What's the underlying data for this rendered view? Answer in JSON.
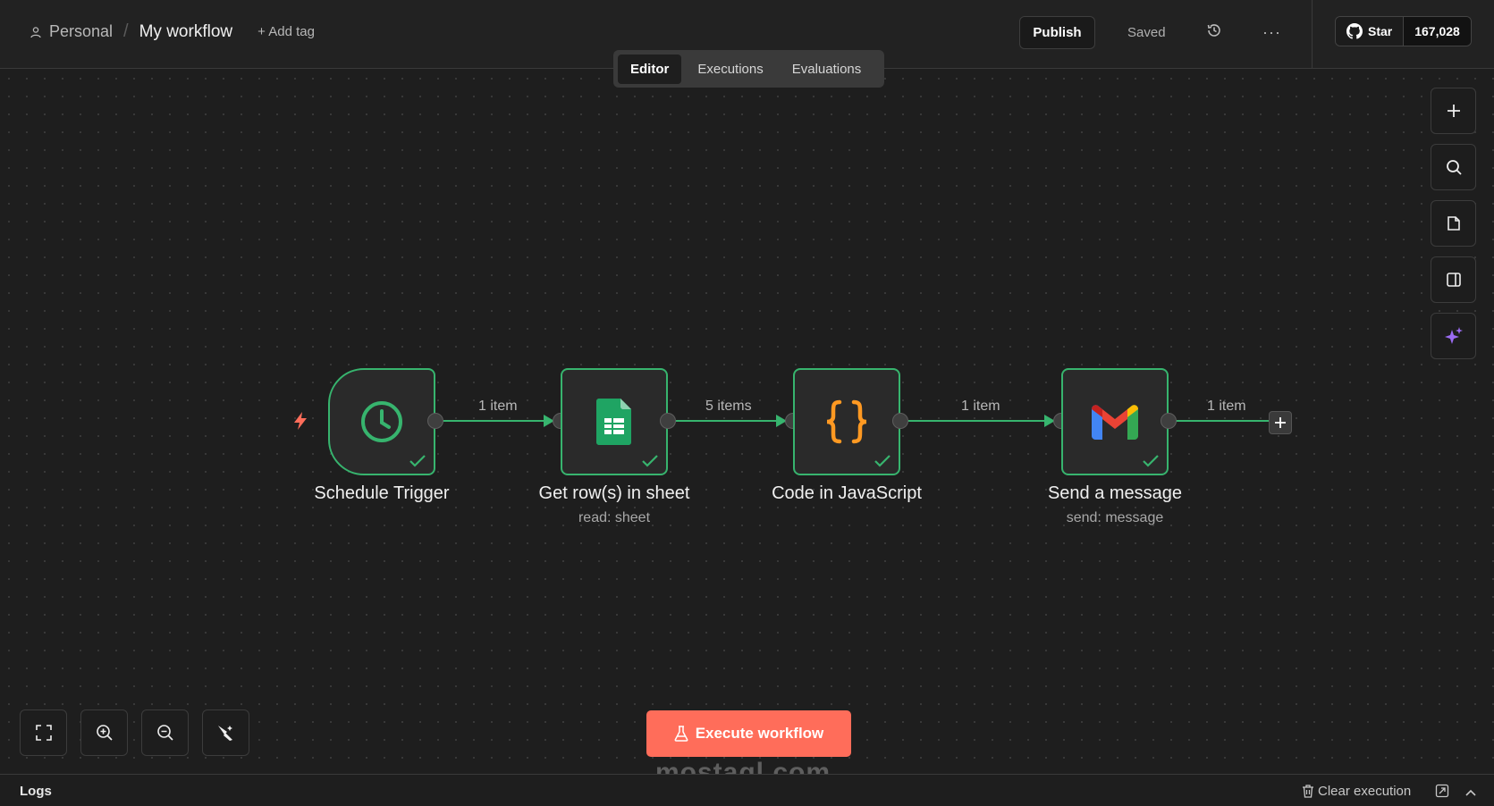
{
  "header": {
    "breadcrumb_project": "Personal",
    "workflow_name": "My workflow",
    "add_tag": "+ Add tag",
    "publish_label": "Publish",
    "saved_label": "Saved",
    "github_star_label": "Star",
    "github_star_count": "167,028"
  },
  "tabs": [
    {
      "label": "Editor",
      "active": true
    },
    {
      "label": "Executions",
      "active": false
    },
    {
      "label": "Evaluations",
      "active": false
    }
  ],
  "nodes": [
    {
      "title": "Schedule Trigger",
      "subtitle": "",
      "icon": "clock-icon",
      "status": "success"
    },
    {
      "title": "Get row(s) in sheet",
      "subtitle": "read: sheet",
      "icon": "google-sheets-icon",
      "status": "success"
    },
    {
      "title": "Code in JavaScript",
      "subtitle": "",
      "icon": "code-braces-icon",
      "status": "success"
    },
    {
      "title": "Send a message",
      "subtitle": "send: message",
      "icon": "gmail-icon",
      "status": "success"
    }
  ],
  "connections": [
    {
      "label": "1 item"
    },
    {
      "label": "5 items"
    },
    {
      "label": "1 item"
    },
    {
      "label": "1 item"
    }
  ],
  "execute_button": {
    "label": "Execute workflow"
  },
  "watermark": "mostaql.com",
  "logs": {
    "title": "Logs",
    "clear_label": "Clear execution"
  },
  "colors": {
    "accent": "#ff6d5a",
    "success": "#37b46e",
    "canvas": "#1e1e1e",
    "node_bg": "#2a2a2a"
  }
}
